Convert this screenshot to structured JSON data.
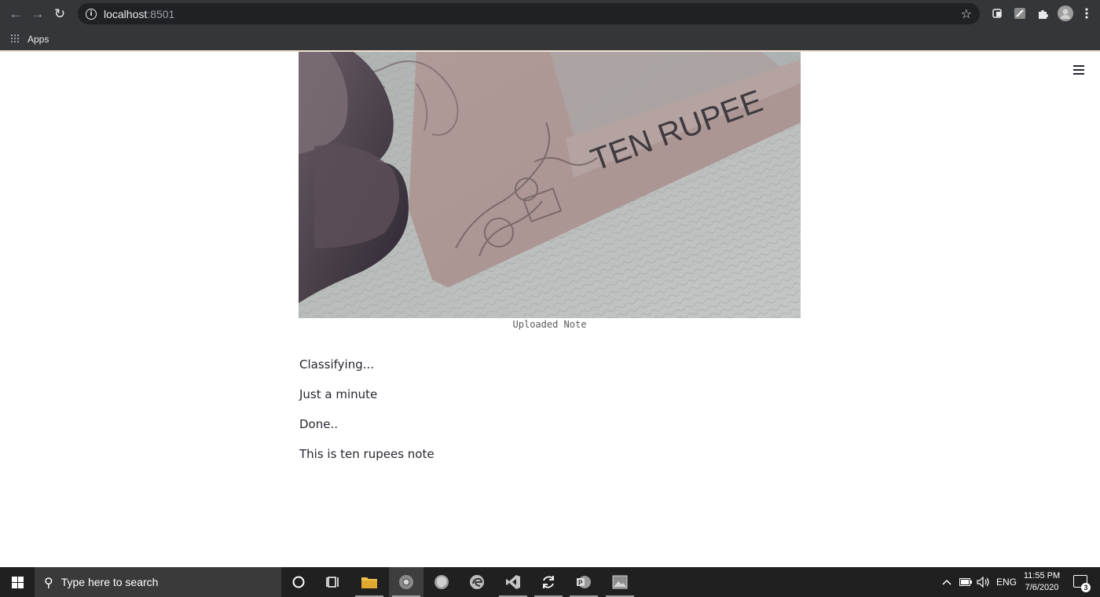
{
  "browser": {
    "url_host": "localhost",
    "url_port": ":8501",
    "bookmark_apps_label": "Apps"
  },
  "page": {
    "image_caption": "Uploaded Note",
    "image_text_banner": "TEN RUPEE",
    "messages": [
      "Classifying...",
      "Just a minute",
      "Done..",
      "This is ten rupees note"
    ]
  },
  "taskbar": {
    "search_placeholder": "Type here to search",
    "language": "ENG",
    "time": "11:55 PM",
    "date": "7/6/2020",
    "notification_count": "3"
  }
}
